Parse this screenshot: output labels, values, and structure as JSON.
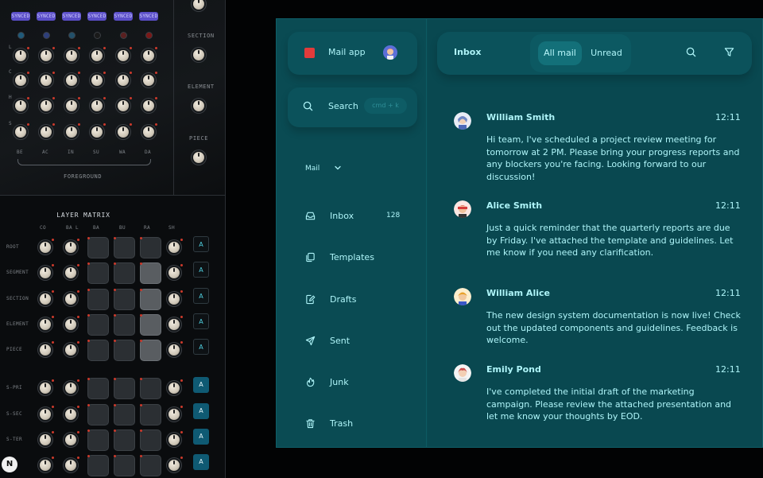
{
  "synth": {
    "synced_label": "SYNCED",
    "side_labels": [
      "SECTION",
      "ELEMENT",
      "PIECE"
    ],
    "row_letters": [
      "L",
      "C",
      "H",
      "S"
    ],
    "column_labels": [
      "BE",
      "AC",
      "IN",
      "SU",
      "WA",
      "DA"
    ],
    "foreground_label": "FOREGROUND",
    "matrix": {
      "title": "LAYER MATRIX",
      "columns": [
        "CO",
        "BA L",
        "BA",
        "BU",
        "RA",
        "SH"
      ],
      "rows": [
        "ROOT",
        "SEGMENT",
        "SECTION",
        "ELEMENT",
        "PIECE",
        "S-PRI",
        "S-SEC",
        "S-TER",
        "A"
      ],
      "button_label": "A"
    },
    "badge": "N",
    "colors": {
      "synced": "#5b4fc9",
      "accent_red": "#cc3a2c",
      "button_blue": "#0f5a73"
    }
  },
  "mail": {
    "app": {
      "name": "Mail app",
      "logo": "red-square-logo",
      "avatar": "user-avatar"
    },
    "search": {
      "label": "Search",
      "shortcut": "cmd + k"
    },
    "account": {
      "label": "Mail"
    },
    "nav": [
      {
        "label": "Inbox",
        "icon": "inbox-icon",
        "count": "128"
      },
      {
        "label": "Templates",
        "icon": "templates-icon",
        "count": ""
      },
      {
        "label": "Drafts",
        "icon": "drafts-icon",
        "count": ""
      },
      {
        "label": "Sent",
        "icon": "send-icon",
        "count": ""
      },
      {
        "label": "Junk",
        "icon": "junk-icon",
        "count": ""
      },
      {
        "label": "Trash",
        "icon": "trash-icon",
        "count": ""
      }
    ],
    "header": {
      "title": "Inbox",
      "tabs": [
        "All mail",
        "Unread"
      ],
      "active_tab": "All mail"
    },
    "messages": [
      {
        "sender": "William Smith",
        "time": "12:11",
        "body": "Hi team, I've scheduled a project review meeting for tomorrow at 2 PM. Please bring your progress reports and any blockers you're facing. Looking forward to our discussion!"
      },
      {
        "sender": "Alice Smith",
        "time": "12:11",
        "body": "Just a quick reminder that the quarterly reports are due by Friday. I've attached the template and guidelines. Let me know if you need any clarification."
      },
      {
        "sender": "William Alice",
        "time": "12:11",
        "body": "The new design system documentation is now live! Check out the updated components and guidelines. Feedback is welcome."
      },
      {
        "sender": "Emily Pond",
        "time": "12:11",
        "body": "I've completed the initial draft of the marketing campaign. Please review the attached presentation and let me know your thoughts by EOD."
      }
    ],
    "colors": {
      "background": "#0a4a52",
      "text": "#aef4f8",
      "logo": "#e23b3b"
    }
  }
}
